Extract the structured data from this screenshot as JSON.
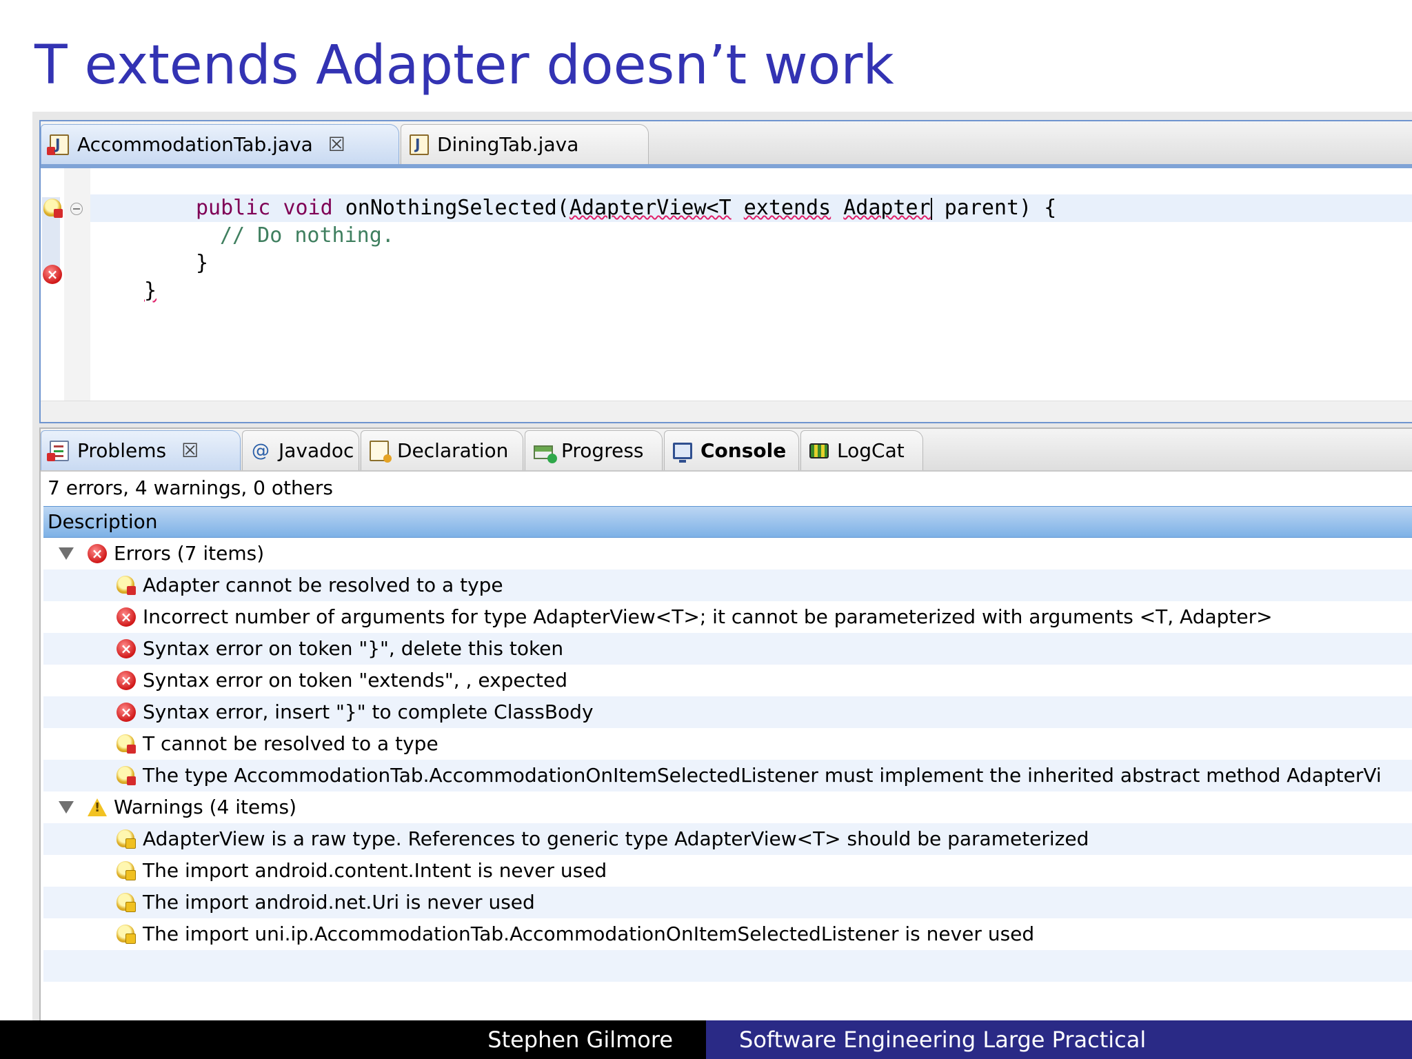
{
  "slide": {
    "title": "T extends Adapter doesn’t work"
  },
  "editor": {
    "tabs": [
      {
        "label": "AccommodationTab.java",
        "icon": "java-file-error-icon",
        "active": true,
        "closable": true
      },
      {
        "label": "DiningTab.java",
        "icon": "java-file-icon",
        "active": false,
        "closable": false
      }
    ],
    "code": {
      "line1_kw1": "public",
      "line1_kw2": "void",
      "line1_method": "onNothingSelected(",
      "line1_err1": "AdapterView<T",
      "line1_err2": "extends",
      "line1_err3": "Adapter",
      "line1_tail": " parent) {",
      "line2_comment": "// Do nothing.",
      "line3": "}",
      "line4": "}"
    }
  },
  "problems_view": {
    "tabs": [
      {
        "label": "Problems",
        "icon": "problems-icon",
        "active": true,
        "closable": true
      },
      {
        "label": "Javadoc",
        "icon": "javadoc-at-icon"
      },
      {
        "label": "Declaration",
        "icon": "declaration-icon"
      },
      {
        "label": "Progress",
        "icon": "progress-icon"
      },
      {
        "label": "Console",
        "icon": "console-icon",
        "bold": true
      },
      {
        "label": "LogCat",
        "icon": "logcat-icon"
      }
    ],
    "summary": "7 errors, 4 warnings, 0 others",
    "column_header": "Description",
    "groups": [
      {
        "label": "Errors (7 items)",
        "icon": "error-icon",
        "items": [
          {
            "icon": "bulb-error-icon",
            "text": "Adapter cannot be resolved to a type"
          },
          {
            "icon": "error-icon",
            "text": "Incorrect number of arguments for type AdapterView<T>; it cannot be parameterized with arguments <T, Adapter>"
          },
          {
            "icon": "error-icon",
            "text": "Syntax error on token \"}\", delete this token"
          },
          {
            "icon": "error-icon",
            "text": "Syntax error on token \"extends\", , expected"
          },
          {
            "icon": "error-icon",
            "text": "Syntax error, insert \"}\" to complete ClassBody"
          },
          {
            "icon": "bulb-error-icon",
            "text": "T cannot be resolved to a type"
          },
          {
            "icon": "bulb-error-icon",
            "text": "The type AccommodationTab.AccommodationOnItemSelectedListener must implement the inherited abstract method AdapterVi"
          }
        ]
      },
      {
        "label": "Warnings (4 items)",
        "icon": "warning-icon",
        "items": [
          {
            "icon": "bulb-warning-icon",
            "text": "AdapterView is a raw type. References to generic type AdapterView<T> should be parameterized"
          },
          {
            "icon": "bulb-warning-icon",
            "text": "The import android.content.Intent is never used"
          },
          {
            "icon": "bulb-warning-icon",
            "text": "The import android.net.Uri is never used"
          },
          {
            "icon": "bulb-warning-icon",
            "text": "The import uni.ip.AccommodationTab.AccommodationOnItemSelectedListener is never used"
          }
        ]
      }
    ]
  },
  "footer": {
    "author": "Stephen Gilmore",
    "course": "Software Engineering Large Practical"
  },
  "colors": {
    "title": "#3333b3",
    "keyword": "#7f0055",
    "comment": "#3f7f5f",
    "footer_right_bg": "#2a2a86"
  }
}
